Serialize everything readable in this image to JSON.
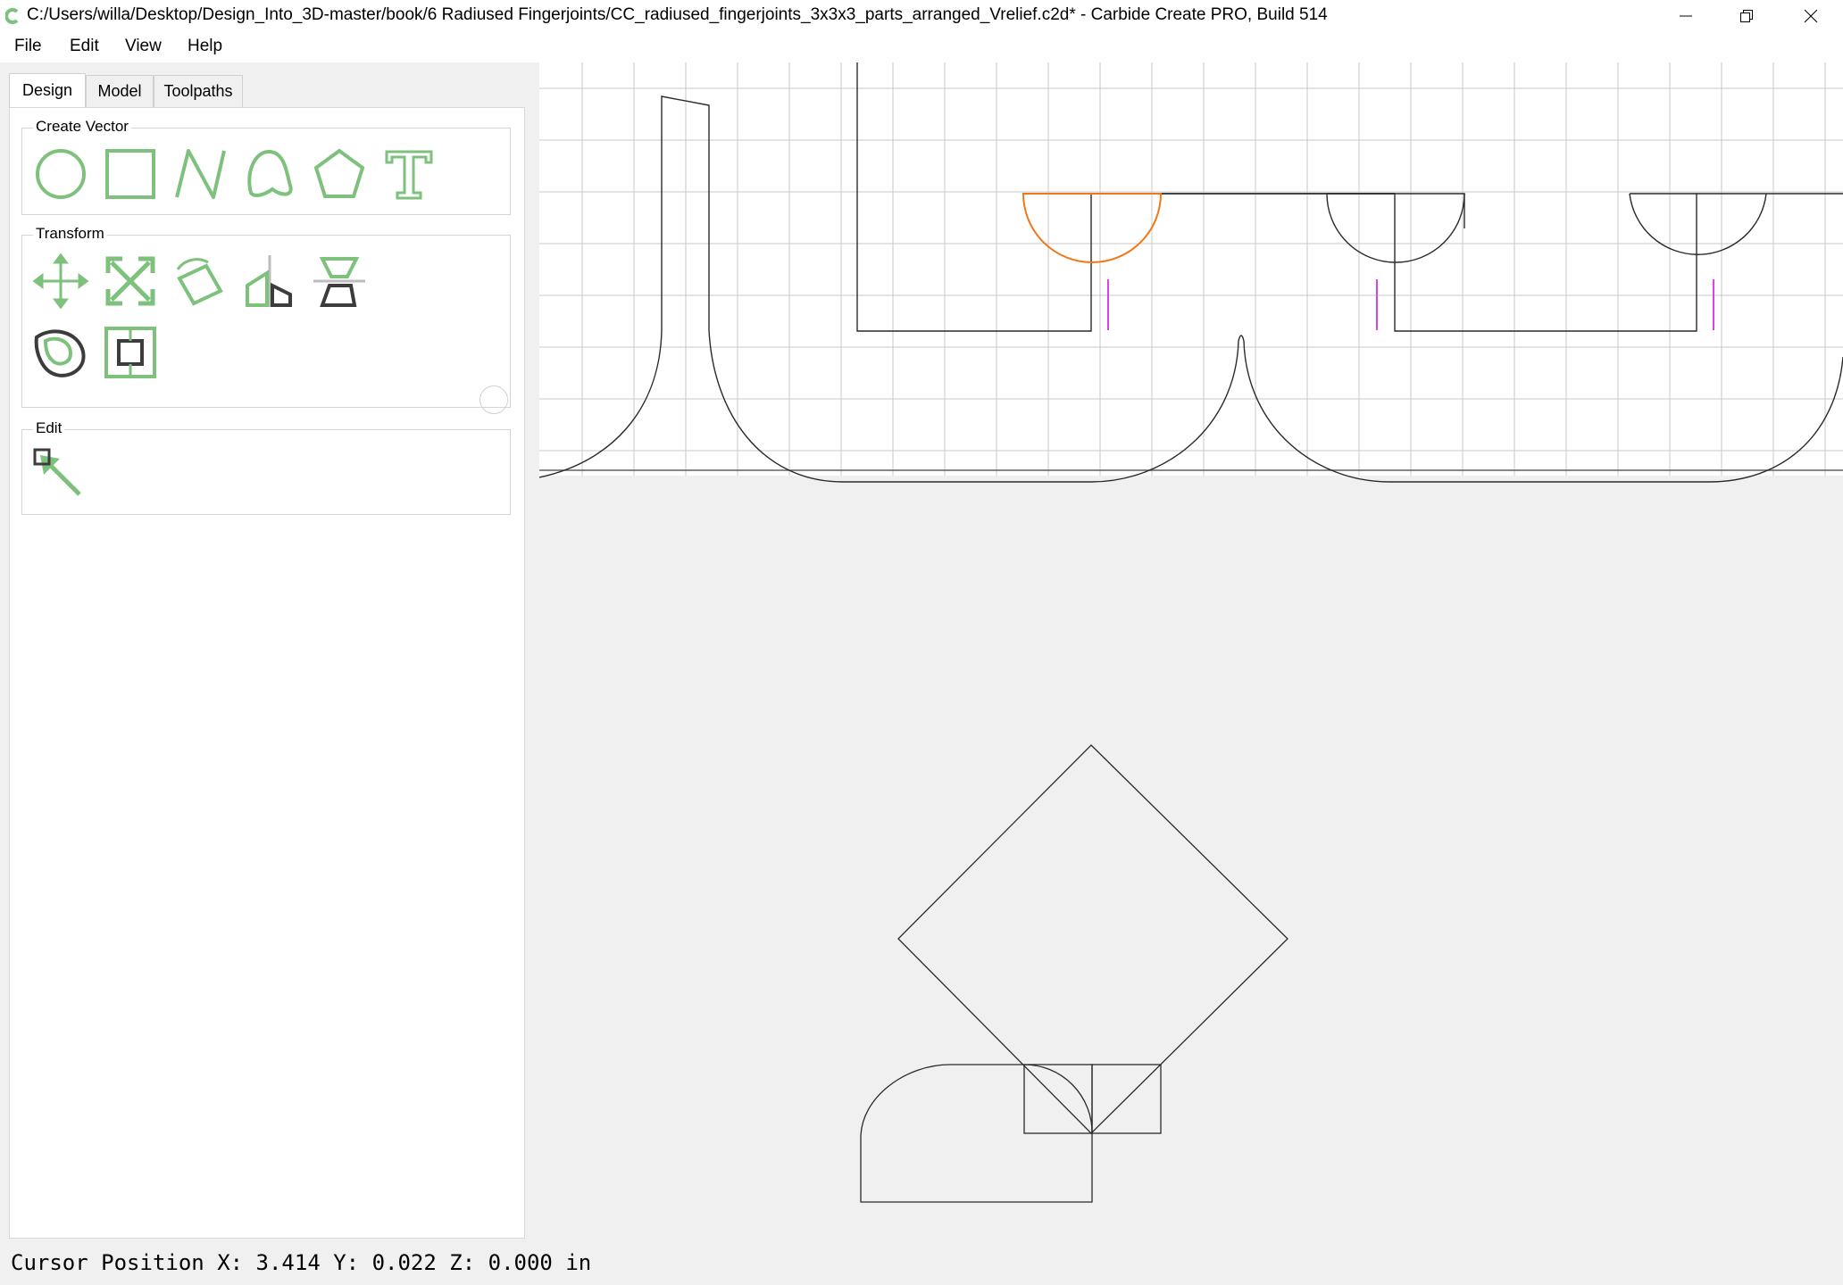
{
  "window": {
    "title": "C:/Users/willa/Desktop/Design_Into_3D-master/book/6 Radiused Fingerjoints/CC_radiused_fingerjoints_3x3x3_parts_arranged_Vrelief.c2d* - Carbide Create PRO, Build 514",
    "controls": [
      "minimize-icon",
      "restore-icon",
      "close-icon"
    ]
  },
  "menu": {
    "file": "File",
    "edit": "Edit",
    "view": "View",
    "help": "Help"
  },
  "tabs": {
    "design": "Design",
    "model": "Model",
    "toolpaths": "Toolpaths",
    "active": "Design"
  },
  "groups": {
    "create_vector": {
      "label": "Create Vector",
      "tools": [
        "circle-icon",
        "rectangle-icon",
        "polyline-icon",
        "curve-icon",
        "polygon-icon",
        "text-icon"
      ]
    },
    "transform": {
      "label": "Transform",
      "tools": [
        "move-icon",
        "scale-icon",
        "rotate-icon",
        "mirror-icon",
        "align-icon",
        "offset-icon",
        "boolean-icon"
      ]
    },
    "edit": {
      "label": "Edit",
      "tools": [
        "node-edit-icon"
      ]
    }
  },
  "status": {
    "cursor_position": "Cursor Position X: 3.414 Y: 0.022 Z: 0.000 in"
  },
  "colors": {
    "tool_green": "#7dc17d",
    "tool_dark": "#3c3c3c",
    "selected_vector": "#f07818",
    "marker_magenta": "#e040e0",
    "grid": "#c8c8c8",
    "vector": "#2a2a2a"
  }
}
